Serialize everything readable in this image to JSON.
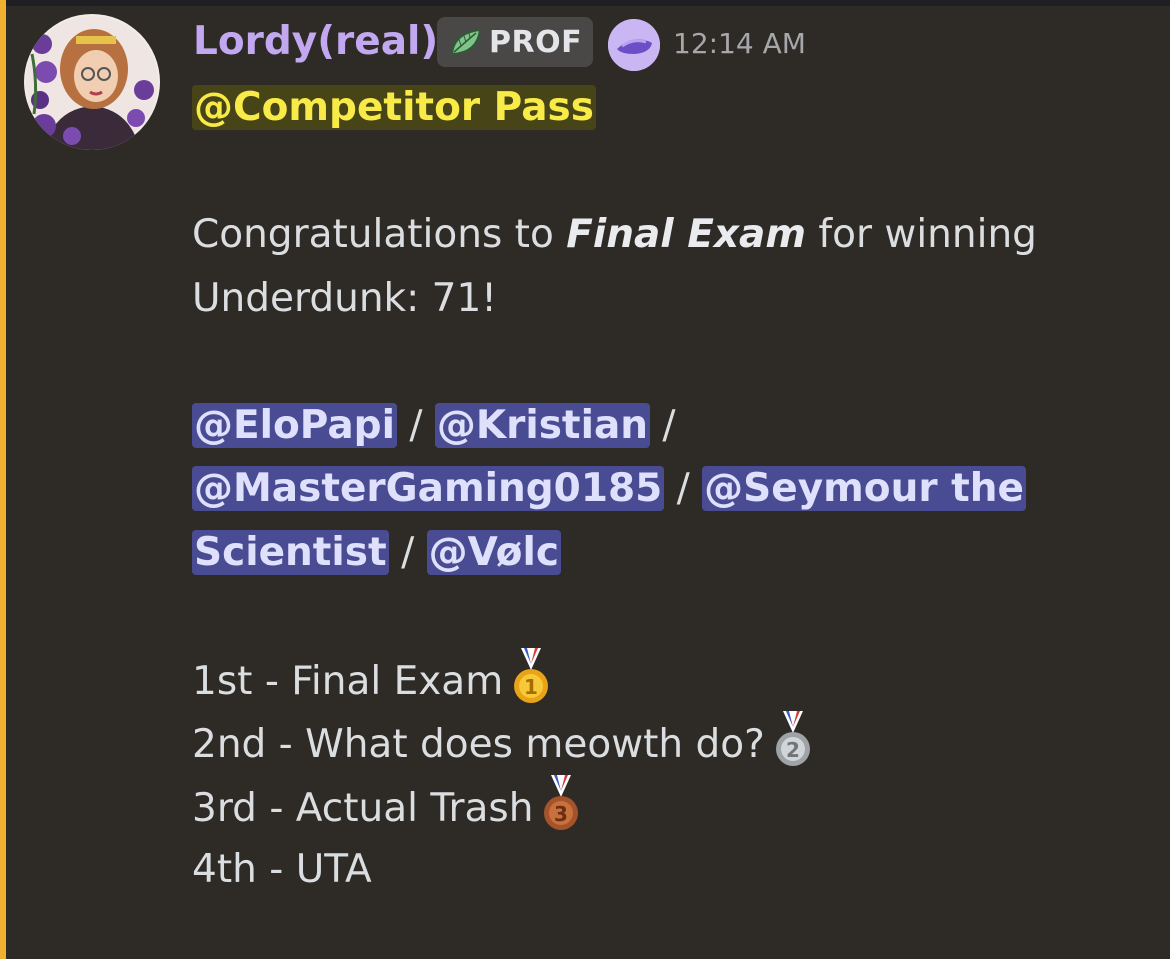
{
  "author": {
    "username": "Lordy(real)",
    "tag_label": "PROF",
    "tag_icon": "leaf-icon",
    "role_icon": "visor-icon",
    "timestamp": "12:14 AM",
    "name_color": "#c2a8f0"
  },
  "message": {
    "role_mention": "@Competitor Pass",
    "congrats": {
      "prefix": "Congratulations to ",
      "team": "Final Exam",
      "suffix": " for winning",
      "line2": "Underdunk: 71!"
    },
    "mentions": [
      "@EloPapi",
      "@Kristian",
      "@MasterGaming0185",
      "@Seymour the",
      "Scientist",
      "@Vølc"
    ],
    "separator": " / ",
    "standings": [
      {
        "text": "1st - Final Exam",
        "medal": "gold-medal-icon"
      },
      {
        "text": "2nd - What does meowth do?",
        "medal": "silver-medal-icon"
      },
      {
        "text": "3rd - Actual Trash",
        "medal": "bronze-medal-icon"
      },
      {
        "text": "4th - UTA",
        "medal": ""
      }
    ],
    "medal_numbers": [
      "1",
      "2",
      "3"
    ]
  },
  "colors": {
    "highlight_bar": "#f0b132",
    "mention_bg": "#4a4c93",
    "role_mention_text": "#f8eb47",
    "background": "#2e2a25"
  }
}
